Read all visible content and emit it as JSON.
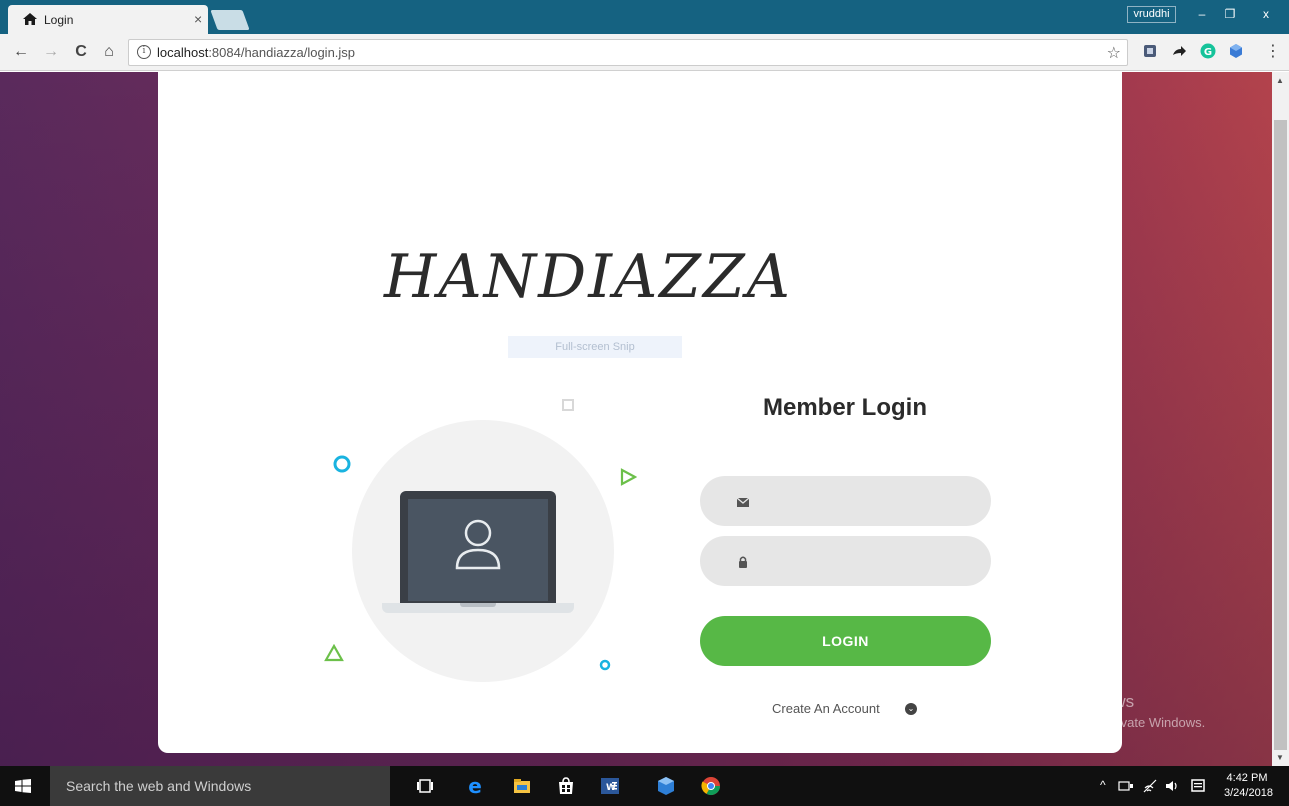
{
  "browser": {
    "tab_title": "Login",
    "tab_close": "×",
    "user_badge": "vruddhi",
    "win_min": "–",
    "win_restore": "❐",
    "win_close": "x",
    "url_host": "localhost",
    "url_rest": ":8084/handiazza/login.jsp",
    "info_glyph": "i",
    "back": "←",
    "forward": "→",
    "reload": "C",
    "home": "⌂",
    "star": "☆",
    "menu": "⋮"
  },
  "page": {
    "brand": "HANDIAZZA",
    "snip_label": "Full-screen Snip",
    "login_title": "Member Login",
    "email_placeholder": "",
    "password_placeholder": "",
    "login_button": "LOGIN",
    "create_account": "Create An Account"
  },
  "watermark": {
    "title": "Activate Windows",
    "subtitle": "Go to Settings to activate Windows."
  },
  "taskbar": {
    "search_placeholder": "Search the web and Windows",
    "time": "4:42 PM",
    "date": "3/24/2018"
  },
  "colors": {
    "chrome_tab_strip": "#156281",
    "login_button": "#57b846",
    "field_bg": "#e6e6e6",
    "accent_cyan": "#19b3e0",
    "accent_green": "#6cc04a"
  },
  "icons": [
    "home-icon",
    "info-icon",
    "star-icon",
    "mail-icon",
    "lock-icon",
    "user-icon",
    "chevron-down-icon",
    "windows-start-icon",
    "edge-icon",
    "explorer-icon",
    "store-icon",
    "word-icon",
    "chrome-icon"
  ]
}
